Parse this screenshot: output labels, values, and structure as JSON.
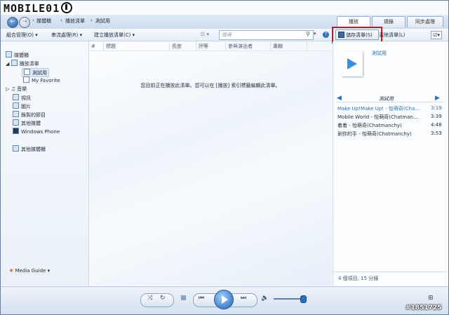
{
  "logo": "MOBILE01",
  "breadcrumb": {
    "items": [
      "媒體櫃",
      "播放清單",
      "測試用"
    ]
  },
  "tabs": [
    {
      "label": "播放"
    },
    {
      "label": "燒錄"
    },
    {
      "label": "同步處理"
    }
  ],
  "toolbar": {
    "organize": "組合管理(O)",
    "stream": "串流處理(R)",
    "create_playlist": "建立播放清單(C)",
    "search_placeholder": "搜尋",
    "save_list": "儲存清單(S)",
    "clear_list": "清除清單(L)"
  },
  "nav": {
    "library": "媒體櫃",
    "playlists": "播放清單",
    "playlist_test": "測試用",
    "playlist_fav": "My Favorite",
    "music": "音樂",
    "video": "視訊",
    "pictures": "圖片",
    "recorded_tv": "錄製的節目",
    "other_media": "其他媒體",
    "windows_phone": "Windows Phone",
    "other_libraries": "其他媒體櫃",
    "media_guide": "Media Guide"
  },
  "columns": [
    "#",
    "標題",
    "長度",
    "評等",
    "參與演出者",
    "專輯"
  ],
  "empty_message": "您目前正在播放此清單。您可以在 [播放] 索引標籤編輯此清單。",
  "right": {
    "album_label": "測試用",
    "list_title": "測試用",
    "tracks": [
      {
        "title": "Make Up!Make Up! - 怡萌奇(Cha...",
        "time": "3:19",
        "current": true
      },
      {
        "title": "Mobile World - 怡萌奇(Chatman...",
        "time": "3:39",
        "current": false
      },
      {
        "title": "着着 - 怡萌奇(Chatmanchy)",
        "time": "4:48",
        "current": false
      },
      {
        "title": "剝你的手 - 怡萌奇(Chatmanchy)",
        "time": "3:53",
        "current": false
      }
    ],
    "summary": "4 個項目, 15 分鐘"
  },
  "watermark": "#1851725",
  "colors": {
    "accent": "#2f6fc3",
    "highlight": "#d6101a",
    "current_track": "#2f6fc3"
  }
}
